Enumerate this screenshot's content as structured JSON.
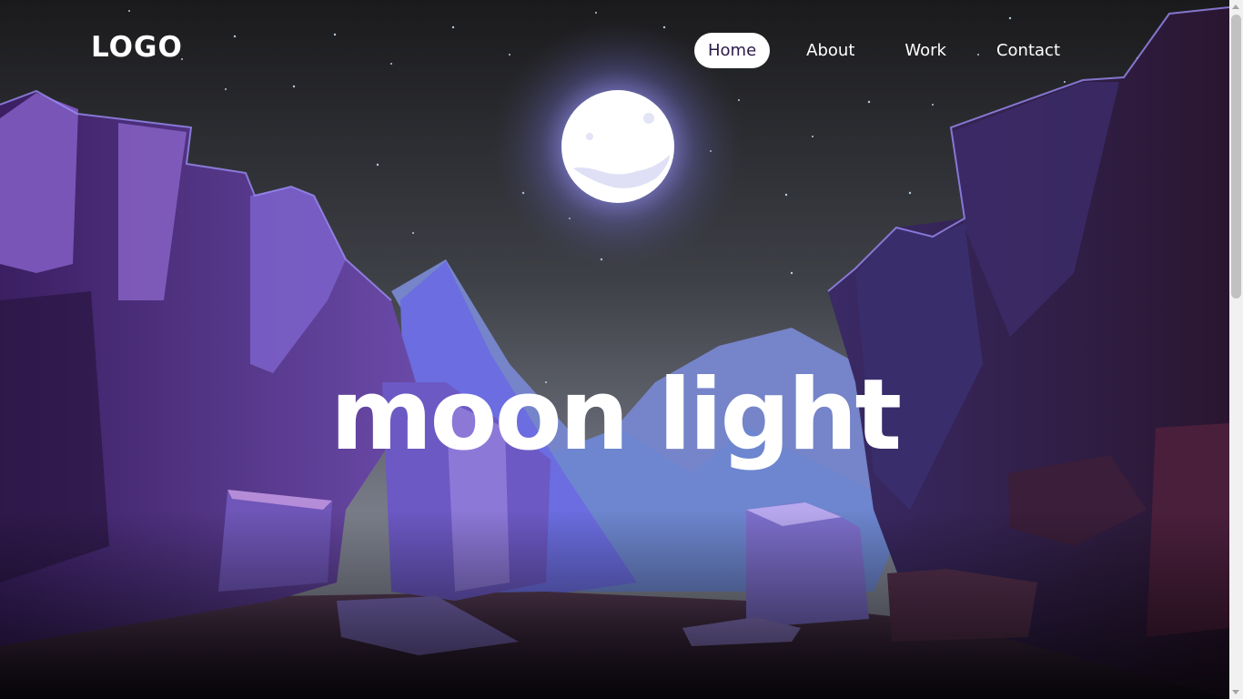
{
  "header": {
    "logo": "LOGO",
    "nav": [
      {
        "label": "Home",
        "active": true
      },
      {
        "label": "About",
        "active": false
      },
      {
        "label": "Work",
        "active": false
      },
      {
        "label": "Contact",
        "active": false
      }
    ]
  },
  "hero": {
    "title": "moon light"
  },
  "colors": {
    "sky_top": "#1b1b1d",
    "sky_bottom": "#7a7d88",
    "moon": "#ffffff",
    "moon_glow": "#8f8cf0",
    "rock_dark": "#2a1840",
    "rock_mid": "#5a3c8e",
    "rock_light": "#8a6ad0",
    "mountain": "#6f7bd8",
    "active_nav_text": "#2a1a4a"
  },
  "icons": {
    "moon": "moon-icon"
  }
}
